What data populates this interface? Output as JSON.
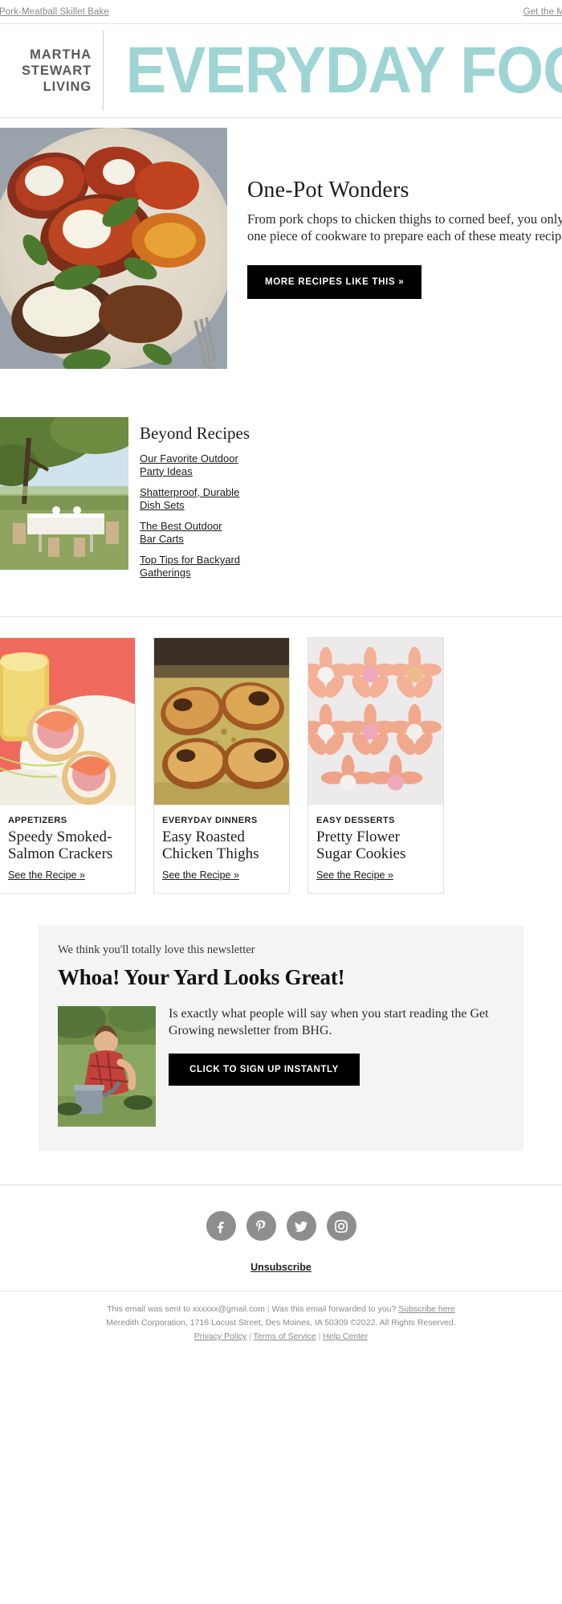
{
  "preheader": {
    "left_link": "Pork-Meatball Skillet Bake",
    "right_link": "Get the Magazine"
  },
  "masthead": {
    "brand_line1": "MARTHA",
    "brand_line2": "STEWART",
    "brand_line3": "LIVING",
    "title": "EVERYDAY FOOD",
    "title_color": "#9ed4d4"
  },
  "hero": {
    "image_alt": "Pork-meatball skillet bake with peppers and basil on a ceramic plate",
    "heading": "One-Pot Wonders",
    "body": "From pork chops to chicken thighs to corned beef, you only need one piece of cookware to prepare each of these meaty recipes.",
    "cta_label": "MORE RECIPES LIKE THIS »"
  },
  "beyond": {
    "image_alt": "Outdoor party table set under a tree",
    "heading": "Beyond Recipes",
    "links": [
      "Our Favorite Outdoor Party Ideas",
      "Shatterproof, Durable Dish Sets",
      "The Best Outdoor Bar Carts",
      "Top Tips for Backyard Gatherings"
    ]
  },
  "cards": [
    {
      "category": "APPETIZERS",
      "title": "Speedy Smoked-Salmon Crackers",
      "link": "See the Recipe »",
      "image_alt": "Smoked salmon on crackers with radish"
    },
    {
      "category": "EVERYDAY DINNERS",
      "title": "Easy Roasted Chicken Thighs",
      "link": "See the Recipe »",
      "image_alt": "Roasted chicken thighs on a sheet pan"
    },
    {
      "category": "EASY DESSERTS",
      "title": "Pretty Flower Sugar Cookies",
      "link": "See the Recipe »",
      "image_alt": "Pink flower-shaped sugar cookies"
    }
  ],
  "promo": {
    "kicker": "We think you'll totally love this newsletter",
    "heading": "Whoa! Your Yard Looks Great!",
    "body": "Is exactly what people will say when you start reading the Get Growing newsletter from BHG.",
    "cta_label": "CLICK TO SIGN UP INSTANTLY",
    "image_alt": "Person in red plaid shirt gardening with a watering can"
  },
  "footer": {
    "social": [
      {
        "name": "facebook",
        "glyph": "f"
      },
      {
        "name": "pinterest",
        "glyph": "P"
      },
      {
        "name": "twitter",
        "glyph": "t"
      },
      {
        "name": "instagram",
        "glyph": "i"
      }
    ],
    "unsubscribe": "Unsubscribe",
    "sent_to_prefix": "This email was sent to ",
    "sent_to_email": "xxxxxx@gmail.com",
    "forwarded_text": "Was this email forwarded to you?",
    "subscribe_link": "Subscribe here",
    "address": "Meredith Corporation, 1716 Locust Street, Des Moines, IA 50309 ©2022. All Rights Reserved.",
    "privacy": "Privacy Policy",
    "terms": "Terms of Service",
    "help": "Help Center",
    "pipe": "|"
  }
}
